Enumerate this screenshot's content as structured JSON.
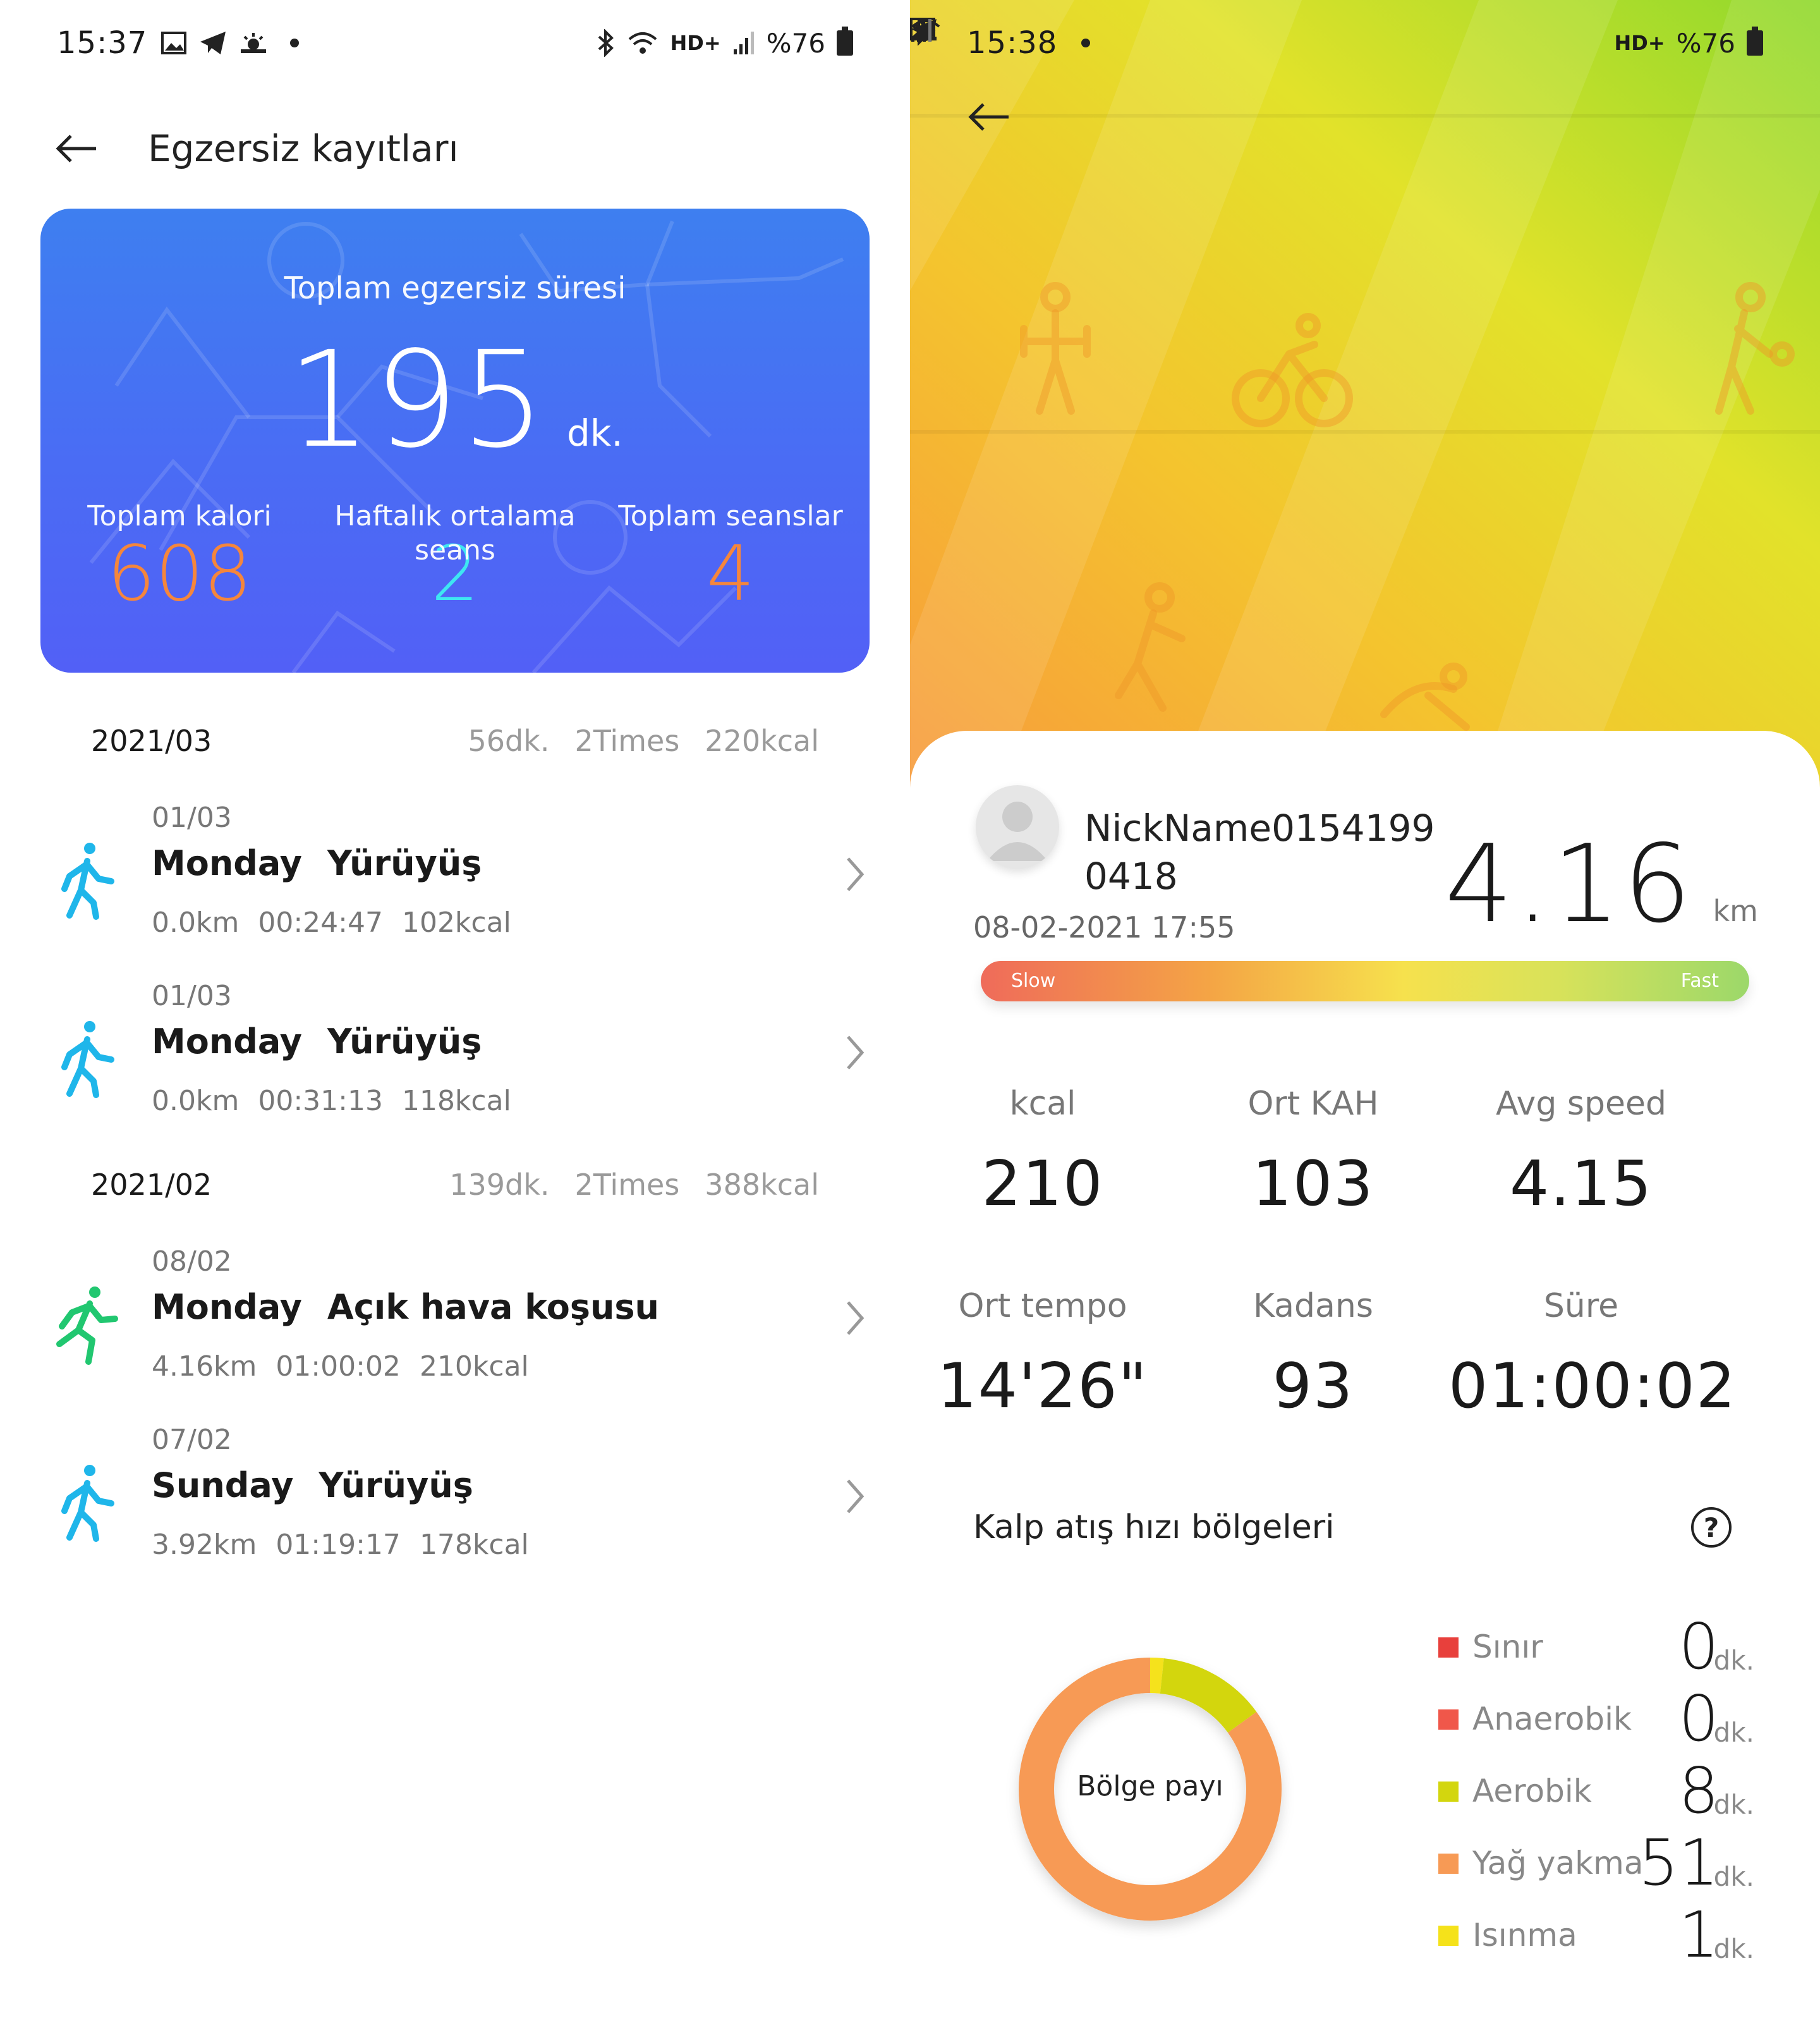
{
  "left": {
    "status": {
      "time": "15:37",
      "network": "HD+",
      "battery": "%76"
    },
    "header": {
      "title": "Egzersiz kayıtları"
    },
    "summary": {
      "total_label": "Toplam egzersiz süresi",
      "total_value": "195",
      "total_unit": "dk.",
      "stats": [
        {
          "label": "Toplam kalori",
          "value": "608",
          "color": "#f5863c"
        },
        {
          "label": "Haftalık ortalama seans",
          "value": "2",
          "color": "#3ee6f2"
        },
        {
          "label": "Toplam seanslar",
          "value": "4",
          "color": "#f5863c"
        }
      ]
    },
    "months": [
      {
        "title": "2021/03",
        "summary": [
          "56dk.",
          "2Times",
          "220kcal"
        ],
        "records": [
          {
            "date": "01/03",
            "day": "Monday",
            "activity": "Yürüyüş",
            "distance": "0.0km",
            "duration": "00:24:47",
            "kcal": "102kcal",
            "icon": "walking-icon"
          },
          {
            "date": "01/03",
            "day": "Monday",
            "activity": "Yürüyüş",
            "distance": "0.0km",
            "duration": "00:31:13",
            "kcal": "118kcal",
            "icon": "walking-icon"
          }
        ]
      },
      {
        "title": "2021/02",
        "summary": [
          "139dk.",
          "2Times",
          "388kcal"
        ],
        "records": [
          {
            "date": "08/02",
            "day": "Monday",
            "activity": "Açık hava koşusu",
            "distance": "4.16km",
            "duration": "01:00:02",
            "kcal": "210kcal",
            "icon": "running-icon"
          },
          {
            "date": "07/02",
            "day": "Sunday",
            "activity": "Yürüyüş",
            "distance": "3.92km",
            "duration": "01:19:17",
            "kcal": "178kcal",
            "icon": "walking-icon"
          }
        ]
      }
    ]
  },
  "right": {
    "status": {
      "time": "15:38",
      "network": "HD+",
      "battery": "%76"
    },
    "user": {
      "nickname": "NickName01541990418",
      "datetime": "08-02-2021 17:55"
    },
    "distance": {
      "value": "4.16",
      "unit": "km"
    },
    "speed_bar": {
      "slow": "Slow",
      "fast": "Fast"
    },
    "metrics": [
      {
        "label": "kcal",
        "value": "210"
      },
      {
        "label": "Ort KAH",
        "value": "103"
      },
      {
        "label": "Avg speed",
        "value": "4.15"
      },
      {
        "label": "Ort tempo",
        "value": "14'26\""
      },
      {
        "label": "Kadans",
        "value": "93"
      },
      {
        "label": "Süre",
        "value": "01:00:02"
      }
    ],
    "heart_rate": {
      "title": "Kalp atış hızı bölgeleri",
      "help": "?",
      "donut_label": "Bölge payı",
      "zones": [
        {
          "name": "Sınır",
          "value": 0,
          "unit": "dk.",
          "color": "#e8403c"
        },
        {
          "name": "Anaerobik",
          "value": 0,
          "unit": "dk.",
          "color": "#f0574a"
        },
        {
          "name": "Aerobik",
          "value": 8,
          "unit": "dk.",
          "color": "#d3d60e"
        },
        {
          "name": "Yağ yakma",
          "value": 51,
          "unit": "dk.",
          "color": "#f79a55"
        },
        {
          "name": "Isınma",
          "value": 1,
          "unit": "dk.",
          "color": "#f5e21a"
        }
      ]
    }
  }
}
